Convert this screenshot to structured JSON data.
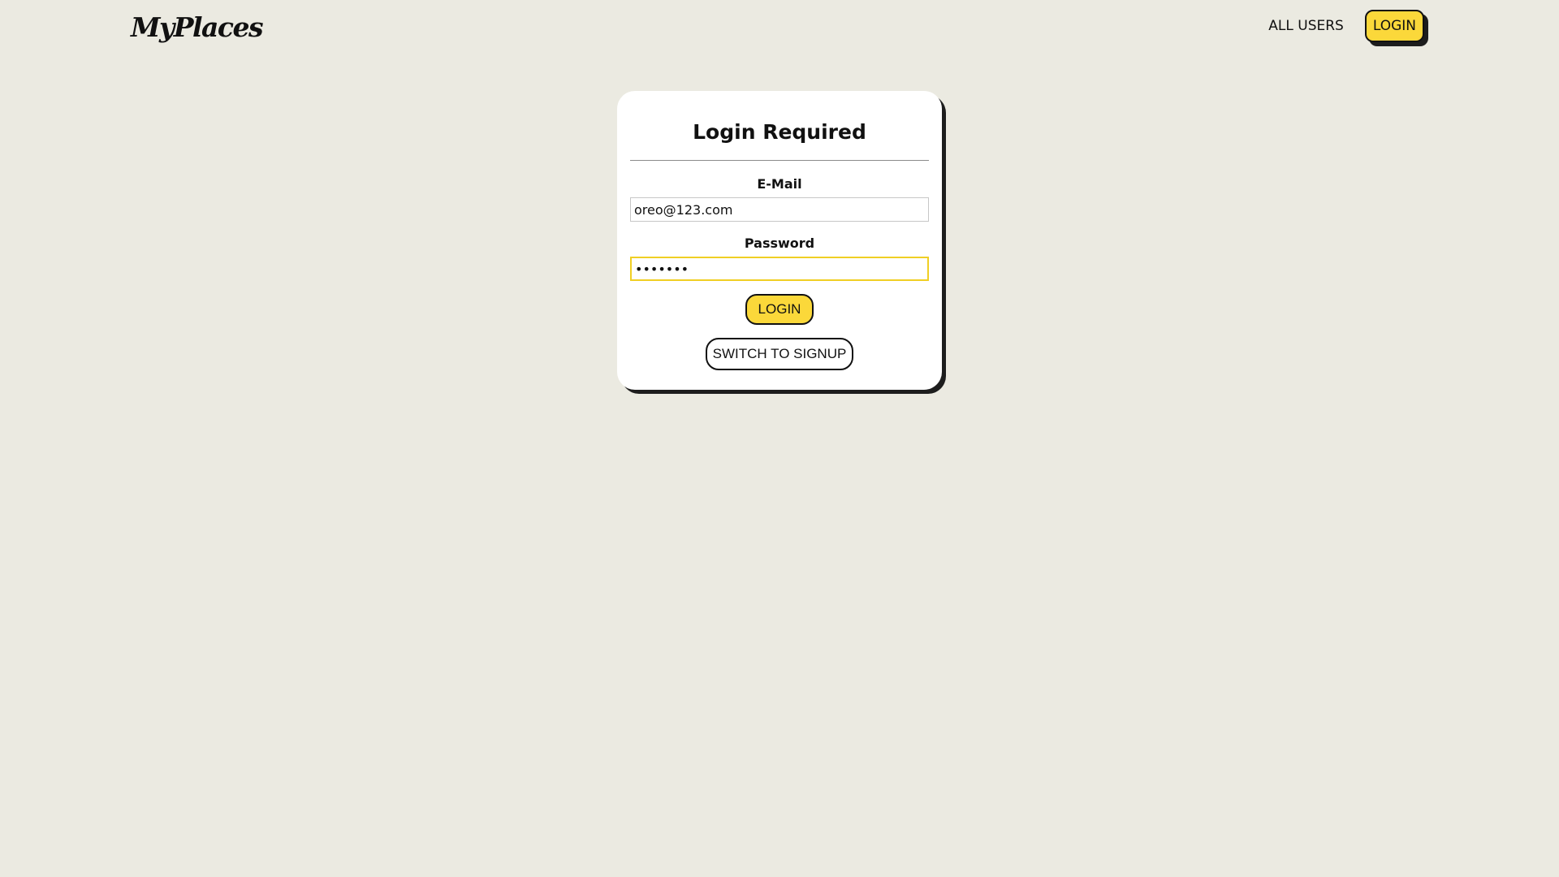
{
  "header": {
    "logo": "MyPlaces",
    "nav": {
      "all_users": "ALL USERS",
      "login": "LOGIN"
    }
  },
  "auth": {
    "title": "Login Required",
    "email": {
      "label": "E-Mail",
      "value": "oreo@123.com"
    },
    "password": {
      "label": "Password",
      "value": "1234567"
    },
    "login_button": "LOGIN",
    "switch_button": "SWITCH TO SIGNUP"
  },
  "colors": {
    "background": "#ebeae1",
    "accent": "#fbd83a",
    "card": "#ffffff",
    "shadow": "#1d1d1d"
  }
}
